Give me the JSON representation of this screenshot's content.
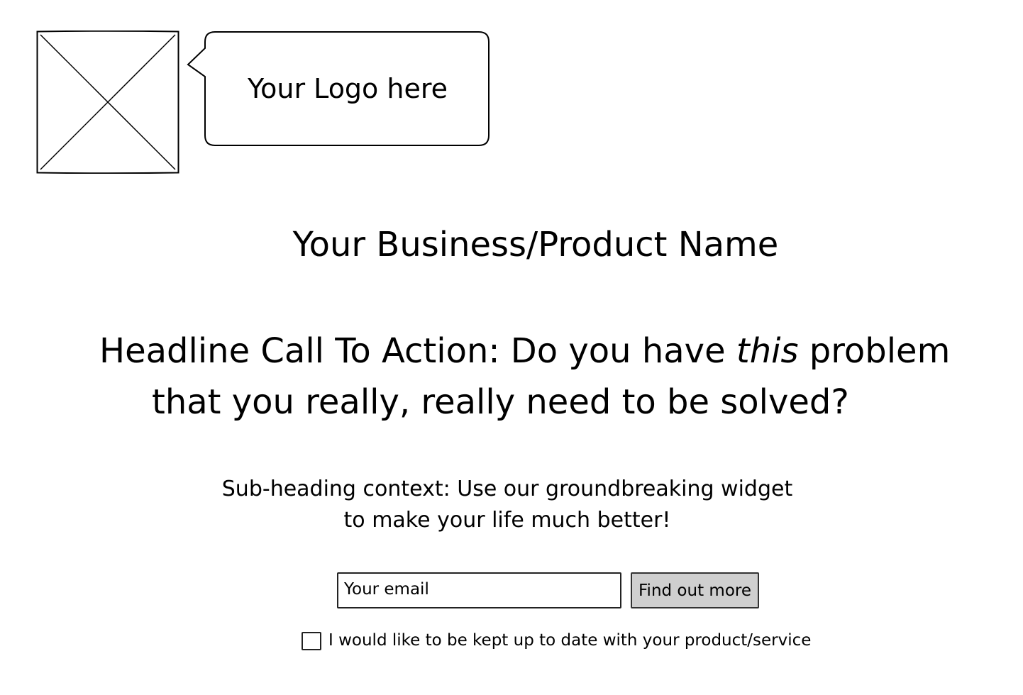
{
  "logo": {
    "image_icon": "image-placeholder-icon",
    "callout_text": "Your Logo here"
  },
  "hero": {
    "business_name": "Your Business/Product Name",
    "headline": {
      "before_emphasis": "Headline Call To Action: Do you have ",
      "emphasis": "this",
      "after_emphasis": " problem",
      "line2": "that you really, really need to be solved?"
    },
    "subheading": {
      "line1": "Sub-heading context:  Use our groundbreaking widget",
      "line2": "to make your life much better!"
    }
  },
  "signup": {
    "email_placeholder": "Your email",
    "email_value": "",
    "button_label": "Find out more",
    "button_color": "#cfcfcf",
    "optin_checked": false,
    "optin_label": "I would like to be kept up to date with your product/service"
  }
}
